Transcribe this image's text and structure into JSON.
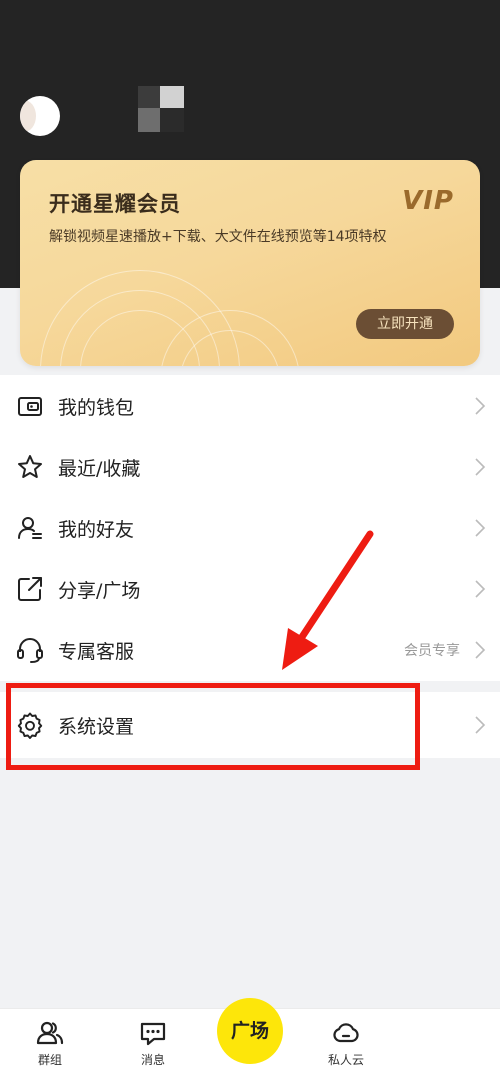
{
  "vip": {
    "title": "开通星耀会员",
    "logo": "VIP",
    "subtitle": "解锁视频星速播放+下载、大文件在线预览等14项特权",
    "cta": "立即开通"
  },
  "menu": [
    {
      "label": "我的钱包",
      "icon": "wallet-icon"
    },
    {
      "label": "最近/收藏",
      "icon": "star-icon"
    },
    {
      "label": "我的好友",
      "icon": "friends-icon"
    },
    {
      "label": "分享/广场",
      "icon": "share-icon"
    },
    {
      "label": "专属客服",
      "icon": "headset-icon",
      "badge": "会员专享"
    },
    {
      "label": "系统设置",
      "icon": "gear-icon"
    }
  ],
  "bottom_nav": {
    "groups": "群组",
    "messages": "消息",
    "plaza": "广场",
    "cloud": "私人云"
  },
  "colors": {
    "header_bg": "#242424",
    "vip_gold": "#f6d89b",
    "vip_button": "#6b4e34",
    "accent_yellow": "#fde60a",
    "annotation_red": "#ee1c12"
  }
}
